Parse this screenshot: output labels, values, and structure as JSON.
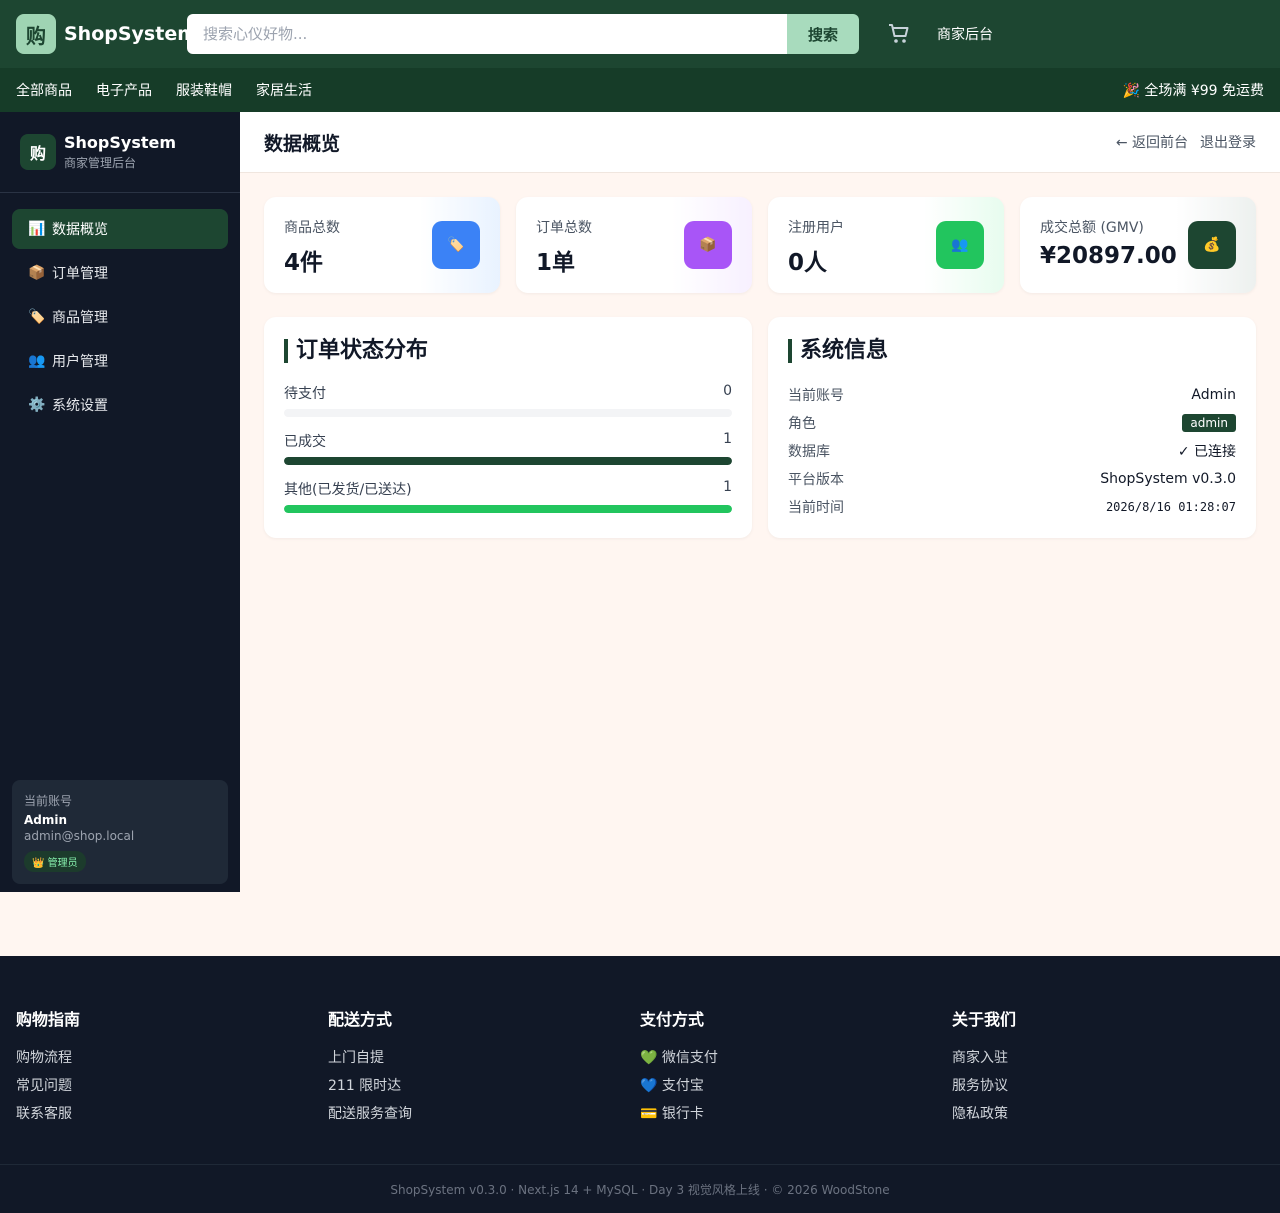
{
  "header": {
    "logo_char": "购",
    "brand": "ShopSystem",
    "search_placeholder": "搜索心仪好物...",
    "search_button": "搜索",
    "merchant_link": "商家后台"
  },
  "categories": [
    "全部商品",
    "电子产品",
    "服装鞋帽",
    "家居生活"
  ],
  "promo": "🎉 全场满 ¥99 免运费",
  "sidebar": {
    "logo_char": "购",
    "title": "ShopSystem",
    "subtitle": "商家管理后台",
    "items": [
      {
        "icon": "📊",
        "label": "数据概览"
      },
      {
        "icon": "📦",
        "label": "订单管理"
      },
      {
        "icon": "🏷️",
        "label": "商品管理"
      },
      {
        "icon": "👥",
        "label": "用户管理"
      },
      {
        "icon": "⚙️",
        "label": "系统设置"
      }
    ],
    "account": {
      "label": "当前账号",
      "name": "Admin",
      "email": "admin@shop.local",
      "badge": "👑 管理员"
    }
  },
  "main": {
    "title": "数据概览",
    "back_link": "← 返回前台",
    "logout": "退出登录"
  },
  "stats": [
    {
      "label": "商品总数",
      "value": "4件",
      "icon": "🏷️",
      "color": "#3b82f6"
    },
    {
      "label": "订单总数",
      "value": "1单",
      "icon": "📦",
      "color": "#a855f7"
    },
    {
      "label": "注册用户",
      "value": "0人",
      "icon": "👥",
      "color": "#22c55e"
    },
    {
      "label": "成交总额 (GMV)",
      "value": "¥20897.00",
      "icon": "💰",
      "color": "#1d4631"
    }
  ],
  "order_status": {
    "title": "订单状态分布",
    "rows": [
      {
        "label": "待支付",
        "count": "0",
        "fraction": 0,
        "color": "#1d4631"
      },
      {
        "label": "已成交",
        "count": "1",
        "fraction": 1,
        "color": "#1d4631"
      },
      {
        "label": "其他(已发货/已送达)",
        "count": "1",
        "fraction": 1,
        "color": "#22c55e"
      }
    ]
  },
  "system_info": {
    "title": "系统信息",
    "rows": {
      "account": {
        "k": "当前账号",
        "v": "Admin"
      },
      "role": {
        "k": "角色",
        "v": "admin"
      },
      "database": {
        "k": "数据库",
        "v": "✓ 已连接"
      },
      "version": {
        "k": "平台版本",
        "v": "ShopSystem v0.3.0"
      },
      "time": {
        "k": "当前时间",
        "v": "2026/8/16 01:28:07"
      }
    }
  },
  "footer": {
    "columns": [
      {
        "title": "购物指南",
        "items": [
          "购物流程",
          "常见问题",
          "联系客服"
        ]
      },
      {
        "title": "配送方式",
        "items": [
          "上门自提",
          "211 限时达",
          "配送服务查询"
        ]
      },
      {
        "title": "支付方式",
        "items": [
          "💚 微信支付",
          "💙 支付宝",
          "💳 银行卡"
        ]
      },
      {
        "title": "关于我们",
        "items": [
          "商家入驻",
          "服务协议",
          "隐私政策"
        ]
      }
    ],
    "copyright": "ShopSystem v0.3.0 · Next.js 14 + MySQL · Day 3 视觉风格上线 · © 2026 WoodStone"
  }
}
